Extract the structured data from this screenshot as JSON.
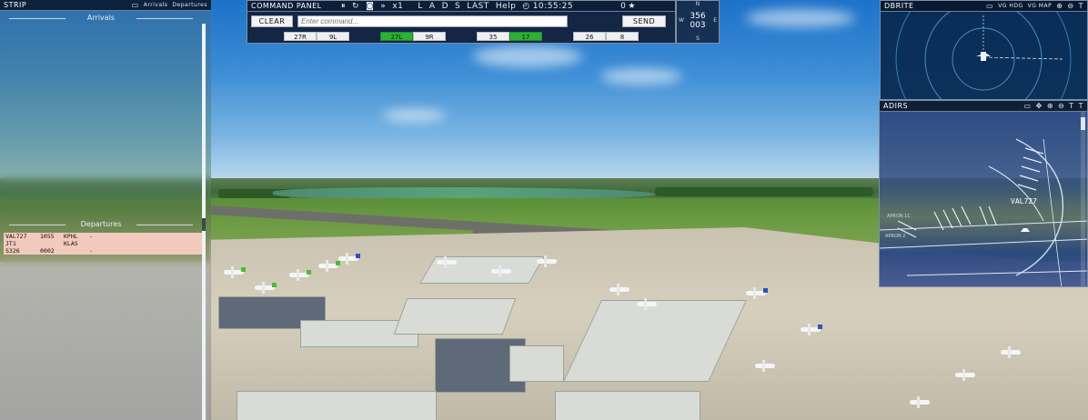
{
  "strip": {
    "title": "STRIP",
    "tabs": [
      "Arrivals",
      "Departures"
    ],
    "arrivals_header": "Arrivals",
    "departures_header": "Departures",
    "departures": [
      {
        "callsign": "VAL727",
        "time": "1055",
        "dest": "KPHL",
        "status": "-"
      },
      {
        "callsign": "JT1",
        "time": "",
        "dest": "KLAS",
        "status": ""
      },
      {
        "callsign": "S326",
        "time": "0002",
        "dest": "",
        "status": "-"
      }
    ],
    "highlight_color": "#f2c9bd"
  },
  "command": {
    "title": "COMMAND PANEL",
    "sim_rate": "x1",
    "mode_letters": [
      "L",
      "A",
      "D",
      "S"
    ],
    "last_label": "LAST",
    "help_label": "Help",
    "clock": "10:55:25",
    "score": "0",
    "clear_label": "CLEAR",
    "input_placeholder": "Enter command...",
    "send_label": "SEND",
    "runways": [
      {
        "label": "27R",
        "active": false
      },
      {
        "label": "9L",
        "active": false
      },
      {
        "label": "27L",
        "active": true
      },
      {
        "label": "9R",
        "active": false
      },
      {
        "label": "35",
        "active": false
      },
      {
        "label": "17",
        "active": true
      },
      {
        "label": "26",
        "active": false
      },
      {
        "label": "8",
        "active": false
      }
    ],
    "active_color": "#2fae3a"
  },
  "heading": {
    "north": "N",
    "south": "S",
    "west": "W",
    "east": "E",
    "value": "356",
    "value2": "003"
  },
  "dbrite": {
    "title": "DBRITE",
    "btn1": "VG HDG",
    "btn2": "VG MAP"
  },
  "adirs": {
    "title": "ADIRS",
    "aircraft_tag": "VAL727",
    "label1": "APRON 1C",
    "label2": "APRON 2"
  },
  "icons": {
    "pause": "pause-icon",
    "refresh": "refresh-icon",
    "camera": "camera-icon",
    "fast_forward": "fast-forward-icon",
    "star": "star-icon",
    "zoom_in": "zoom-in-icon",
    "zoom_out": "zoom-out-icon",
    "text_size": "text-size-icon",
    "window": "window-toggle-icon",
    "move": "move-icon",
    "close": "close-icon"
  }
}
